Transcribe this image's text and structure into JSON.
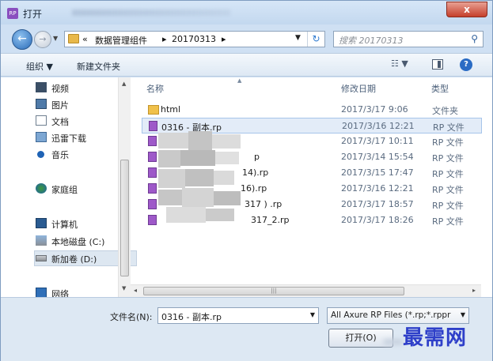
{
  "window": {
    "title": "打开",
    "app_icon_text": "RP",
    "close_label": "x"
  },
  "navigation": {
    "breadcrumb": [
      "«",
      "数据管理组件",
      "20170313"
    ],
    "search_placeholder": "搜索 20170313"
  },
  "toolbar": {
    "organize_label": "组织 ▼",
    "new_folder_label": "新建文件夹"
  },
  "nav_pane": {
    "items": [
      {
        "label": "视频",
        "icon": "video-library-icon"
      },
      {
        "label": "图片",
        "icon": "pictures-library-icon"
      },
      {
        "label": "文档",
        "icon": "documents-library-icon"
      },
      {
        "label": "迅雷下载",
        "icon": "download-folder-icon"
      },
      {
        "label": "音乐",
        "icon": "music-library-icon"
      },
      {
        "label": "家庭组",
        "icon": "homegroup-icon"
      },
      {
        "label": "计算机",
        "icon": "computer-icon"
      },
      {
        "label": "本地磁盘 (C:)",
        "icon": "local-disk-icon"
      },
      {
        "label": "新加卷 (D:)",
        "icon": "drive-icon"
      },
      {
        "label": "网络",
        "icon": "network-icon"
      }
    ]
  },
  "file_list": {
    "columns": [
      "名称",
      "修改日期",
      "类型"
    ],
    "rows": [
      {
        "name": "html",
        "modified": "2017/3/17 9:06",
        "type": "文件夹",
        "icon": "folder-icon"
      },
      {
        "name": "0316 - 副本.rp",
        "modified": "2017/3/16 12:21",
        "type": "RP 文件",
        "icon": "rp-file-icon"
      },
      {
        "name": "",
        "modified": "2017/3/17 10:11",
        "type": "RP 文件",
        "icon": "rp-file-icon"
      },
      {
        "name": "p",
        "modified": "2017/3/14 15:54",
        "type": "RP 文件",
        "icon": "rp-file-icon"
      },
      {
        "name": "14).rp",
        "modified": "2017/3/15 17:47",
        "type": "RP 文件",
        "icon": "rp-file-icon"
      },
      {
        "name": "16).rp",
        "modified": "2017/3/16 12:21",
        "type": "RP 文件",
        "icon": "rp-file-icon"
      },
      {
        "name": "317 ) .rp",
        "modified": "2017/3/17 18:57",
        "type": "RP 文件",
        "icon": "rp-file-icon"
      },
      {
        "name": "317_2.rp",
        "modified": "2017/3/17 18:26",
        "type": "RP 文件",
        "icon": "rp-file-icon"
      }
    ]
  },
  "footer": {
    "filename_label": "文件名(N):",
    "filename_value": "0316 - 副本.rp",
    "filter_value": "All Axure RP Files (*.rp;*.rppr",
    "open_label": "打开(O)"
  },
  "watermark": "最需网"
}
